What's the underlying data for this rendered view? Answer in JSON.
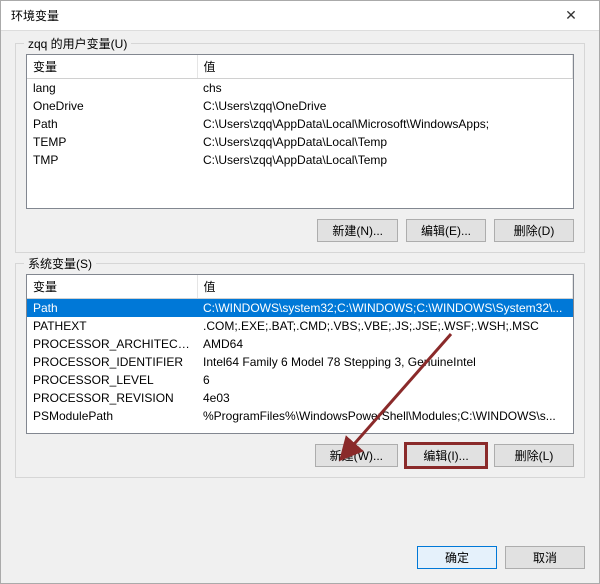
{
  "window": {
    "title": "环境变量",
    "close_label": "✕"
  },
  "user_group": {
    "label": "zqq 的用户变量(U)",
    "columns": {
      "name": "变量",
      "value": "值"
    },
    "rows": [
      {
        "name": "lang",
        "value": "chs"
      },
      {
        "name": "OneDrive",
        "value": "C:\\Users\\zqq\\OneDrive"
      },
      {
        "name": "Path",
        "value": "C:\\Users\\zqq\\AppData\\Local\\Microsoft\\WindowsApps;"
      },
      {
        "name": "TEMP",
        "value": "C:\\Users\\zqq\\AppData\\Local\\Temp"
      },
      {
        "name": "TMP",
        "value": "C:\\Users\\zqq\\AppData\\Local\\Temp"
      }
    ],
    "buttons": {
      "new": "新建(N)...",
      "edit": "编辑(E)...",
      "delete": "删除(D)"
    }
  },
  "system_group": {
    "label": "系统变量(S)",
    "columns": {
      "name": "变量",
      "value": "值"
    },
    "selected_index": 0,
    "rows": [
      {
        "name": "Path",
        "value": "C:\\WINDOWS\\system32;C:\\WINDOWS;C:\\WINDOWS\\System32\\..."
      },
      {
        "name": "PATHEXT",
        "value": ".COM;.EXE;.BAT;.CMD;.VBS;.VBE;.JS;.JSE;.WSF;.WSH;.MSC"
      },
      {
        "name": "PROCESSOR_ARCHITECTURE",
        "value": "AMD64"
      },
      {
        "name": "PROCESSOR_IDENTIFIER",
        "value": "Intel64 Family 6 Model 78 Stepping 3, GenuineIntel"
      },
      {
        "name": "PROCESSOR_LEVEL",
        "value": "6"
      },
      {
        "name": "PROCESSOR_REVISION",
        "value": "4e03"
      },
      {
        "name": "PSModulePath",
        "value": "%ProgramFiles%\\WindowsPowerShell\\Modules;C:\\WINDOWS\\s..."
      }
    ],
    "buttons": {
      "new": "新建(W)...",
      "edit": "编辑(I)...",
      "delete": "删除(L)"
    }
  },
  "footer": {
    "ok": "确定",
    "cancel": "取消"
  }
}
